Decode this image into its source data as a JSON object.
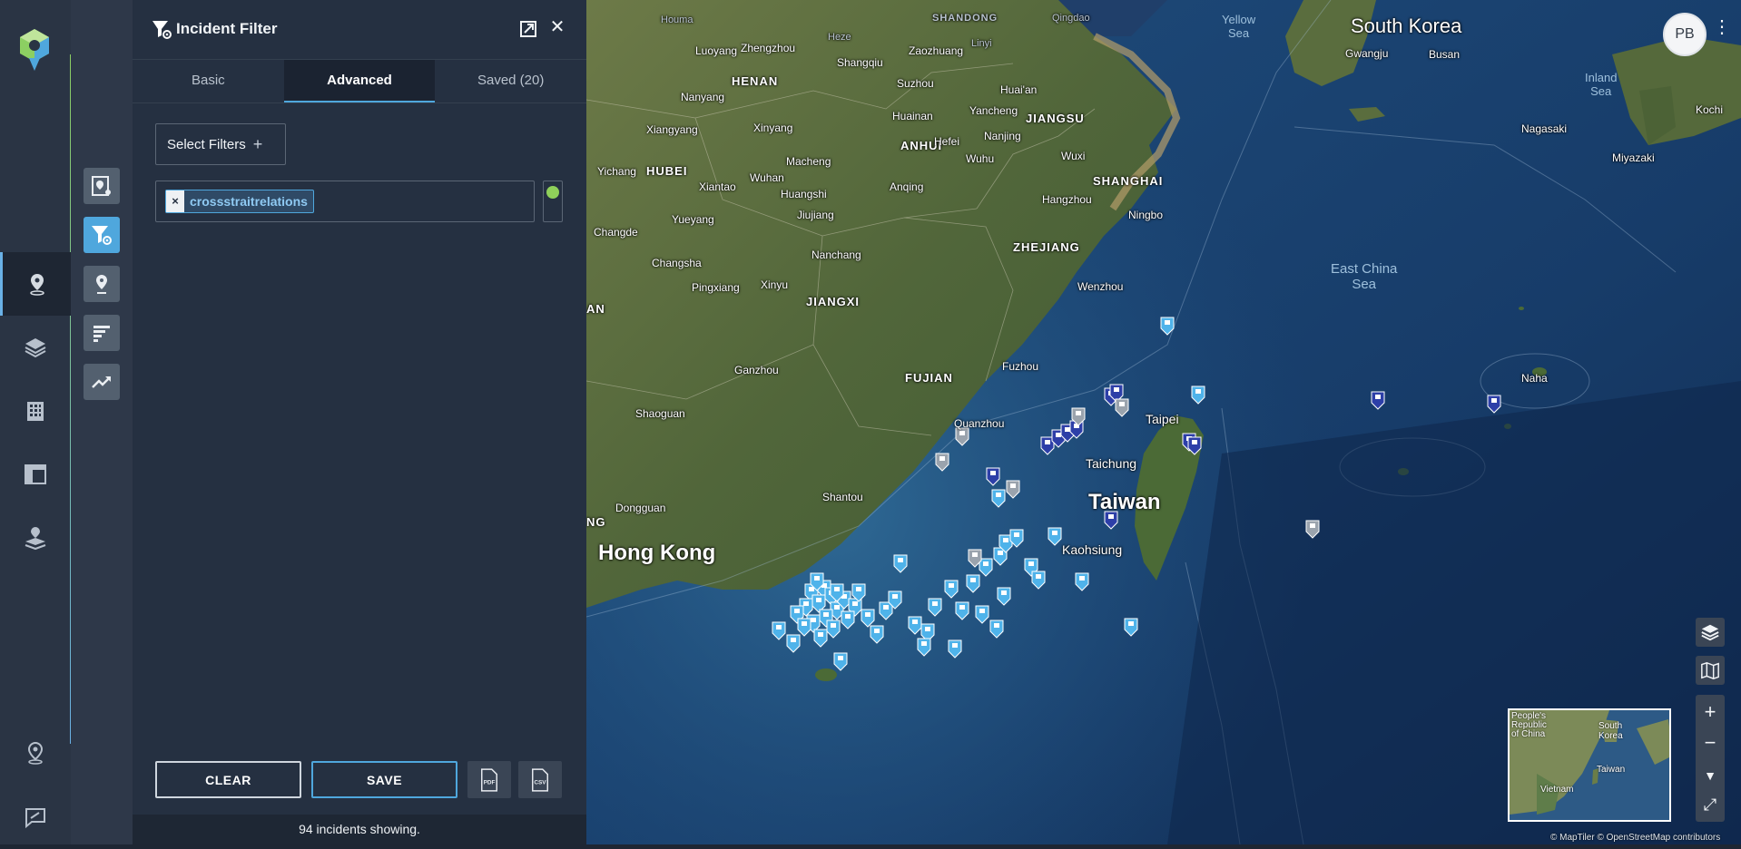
{
  "app": {
    "logo_name": "app-logo",
    "accent_color": "#4fa7dd",
    "brand_green": "#8ccf62"
  },
  "rail": {
    "items": [
      {
        "name": "incidents",
        "icon": "map-pin-icon",
        "active": true
      },
      {
        "name": "layers",
        "icon": "layers-icon",
        "active": false
      },
      {
        "name": "facilities",
        "icon": "building-icon",
        "active": false
      },
      {
        "name": "dashboard",
        "icon": "layout-icon",
        "active": false
      },
      {
        "name": "stacked-pins",
        "icon": "stacked-pin-icon",
        "active": false
      },
      {
        "name": "location",
        "icon": "location-pin-icon",
        "active": false
      },
      {
        "name": "feedback",
        "icon": "feedback-icon",
        "active": false
      }
    ]
  },
  "tools": {
    "items": [
      {
        "name": "map-report",
        "icon": "map-report-icon",
        "active": false
      },
      {
        "name": "incident-filter",
        "icon": "filter-gear-icon",
        "active": true
      },
      {
        "name": "pin",
        "icon": "pin-icon",
        "active": false
      },
      {
        "name": "bar-chart",
        "icon": "bar-chart-icon",
        "active": false
      },
      {
        "name": "trend",
        "icon": "trend-icon",
        "active": false
      }
    ]
  },
  "panel": {
    "title": "Incident Filter",
    "tabs": [
      {
        "label": "Basic",
        "active": false
      },
      {
        "label": "Advanced",
        "active": true
      },
      {
        "label": "Saved (20)",
        "active": false
      }
    ],
    "select_filters_label": "Select Filters",
    "select_filters_icon": "plus-icon",
    "tags": [
      {
        "label": "crossstraitrelations",
        "remove": "×"
      }
    ],
    "swatch_color": "#8fd05a",
    "clear_label": "CLEAR",
    "save_label": "SAVE",
    "pdf_label": "PDF",
    "csv_label": "CSV",
    "status": "94 incidents showing."
  },
  "map": {
    "places": {
      "south_korea": "South Korea",
      "hong_kong": "Hong Kong",
      "taiwan": "Taiwan",
      "east_china_sea": "East China\nSea",
      "yellow_sea": "Yellow\nSea",
      "inland_sea": "Inland\nSea",
      "henan": "HENAN",
      "hubei": "HUBEI",
      "anhui": "ANHUI",
      "jiangsu": "JIANGSU",
      "shanghai": "SHANGHAI",
      "zhejiang": "ZHEJIANG",
      "jiangxi": "JIANGXI",
      "fujian": "FUJIAN",
      "shandong": "SHANDONG",
      "luoyang": "Luoyang",
      "zhengzhou": "Zhengzhou",
      "heze": "Heze",
      "zaozhuang": "Zaozhuang",
      "linyi": "Linyi",
      "qingdao": "Qingdao",
      "houma": "Houma",
      "nanyang": "Nanyang",
      "shangqiu": "Shangqiu",
      "suzhou_n": "Suzhou",
      "huaian": "Huai'an",
      "xiangyang": "Xiangyang",
      "xinyang": "Xinyang",
      "huainan": "Huainan",
      "yancheng": "Yancheng",
      "nanjing": "Nanjing",
      "hefei": "Hefei",
      "yichang": "Yichang",
      "macheng": "Macheng",
      "wuhu": "Wuhu",
      "wuxi": "Wuxi",
      "xiantao": "Xiantao",
      "wuhan": "Wuhan",
      "huangshi": "Huangshi",
      "anqing": "Anqing",
      "hangzhou": "Hangzhou",
      "ningbo": "Ningbo",
      "changde": "Changde",
      "yueyang": "Yueyang",
      "jiujiang": "Jiujiang",
      "changsha": "Changsha",
      "nanchang": "Nanchang",
      "pingxiang": "Pingxiang",
      "xinyu": "Xinyu",
      "wenzhou": "Wenzhou",
      "ganzhou": "Ganzhou",
      "fuzhou": "Fuzhou",
      "shaoguan": "Shaoguan",
      "quanzhou": "Quanzhou",
      "taipei": "Taipei",
      "taichung": "Taichung",
      "shantou": "Shantou",
      "dongguan": "Dongguan",
      "kaohsiung": "Kaohsiung",
      "gwangju": "Gwangju",
      "busan": "Busan",
      "nagasaki": "Nagasaki",
      "miyazaki": "Miyazaki",
      "kochi": "Kochi",
      "naha": "Naha",
      "an": "AN",
      "ng": "NG"
    },
    "avatar_initials": "PB",
    "kebab": "⋮",
    "zoom_in": "+",
    "zoom_out": "−",
    "minimap": {
      "prc": "People's\nRepublic\nof China",
      "south_korea": "South\nKorea",
      "taiwan": "Taiwan",
      "vietnam": "Vietnam"
    },
    "attribution": "© MapTiler © OpenStreetMap contributors",
    "incident_count": 94,
    "marker_colors": {
      "light": "#4fb3ea",
      "dark": "#2d3fa8",
      "gray": "#9aa3ad"
    }
  }
}
